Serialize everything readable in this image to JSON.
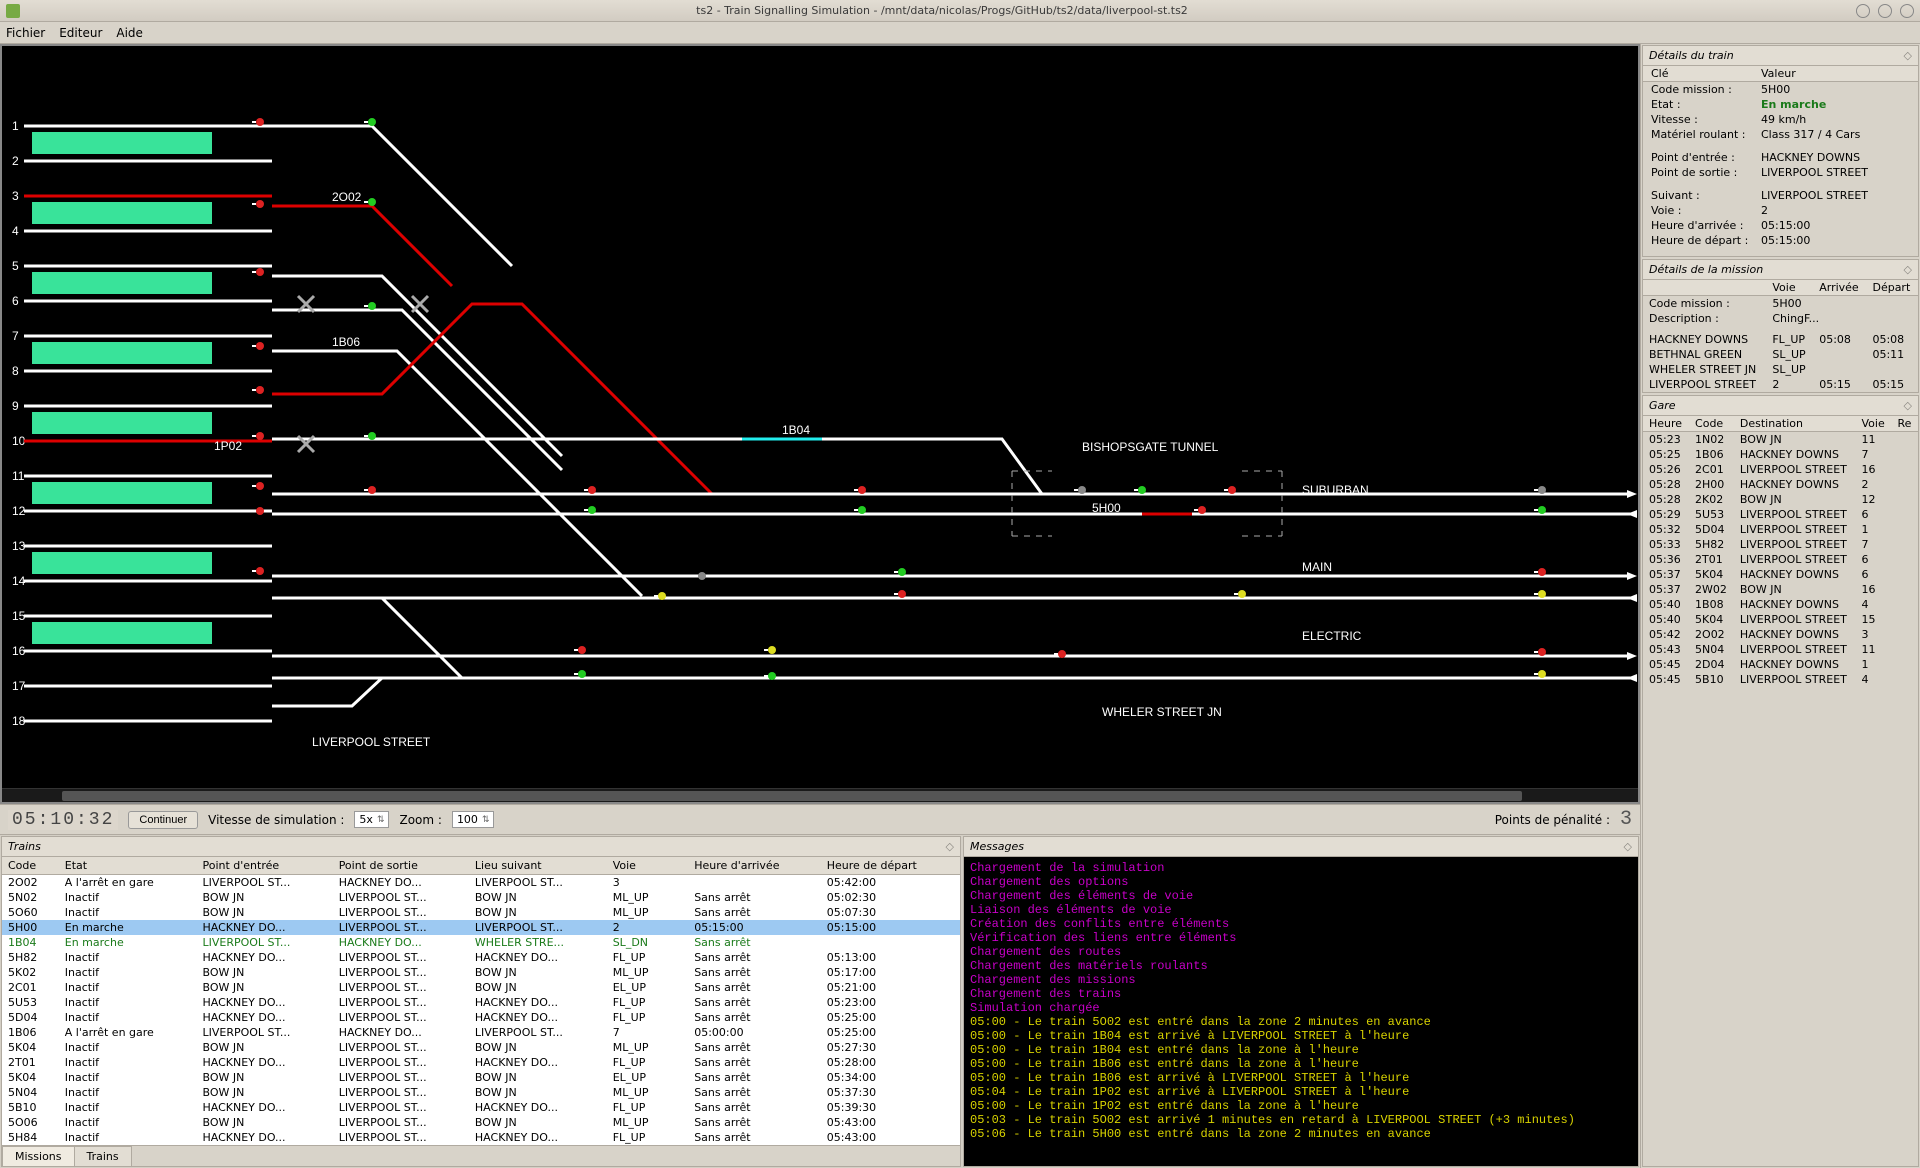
{
  "window": {
    "title": "ts2 - Train Signalling Simulation - /mnt/data/nicolas/Progs/GitHub/ts2/data/liverpool-st.ts2"
  },
  "menubar": {
    "file": "Fichier",
    "edit": "Editeur",
    "help": "Aide"
  },
  "track_labels": {
    "station": "LIVERPOOL STREET",
    "tunnel": "BISHOPSGATE TUNNEL",
    "wheler": "WHELER STREET JN",
    "suburban": "SUBURBAN",
    "main": "MAIN",
    "electric": "ELECTRIC",
    "t2002": "2O02",
    "t1B06": "1B06",
    "t1P02": "1P02",
    "t1B04": "1B04",
    "t5H00": "5H00"
  },
  "platform_numbers": [
    "1",
    "2",
    "3",
    "4",
    "5",
    "6",
    "7",
    "8",
    "9",
    "10",
    "11",
    "12",
    "13",
    "14",
    "15",
    "16",
    "17",
    "18"
  ],
  "controls": {
    "clock": "05:10:32",
    "continue_btn": "Continuer",
    "sim_speed_label": "Vitesse de simulation :",
    "sim_speed_value": "5x",
    "zoom_label": "Zoom :",
    "zoom_value": "100",
    "penalty_label": "Points de pénalité :",
    "penalty_value": "3"
  },
  "details": {
    "header": "Détails du train",
    "col_key": "Clé",
    "col_val": "Valeur",
    "rows": [
      {
        "k": "Code mission :",
        "v": "5H00"
      },
      {
        "k": "Etat :",
        "v": "En marche",
        "green": true
      },
      {
        "k": "Vitesse :",
        "v": "49 km/h"
      },
      {
        "k": "Matériel roulant :",
        "v": "Class 317 / 4 Cars"
      }
    ],
    "rows2": [
      {
        "k": "Point d'entrée :",
        "v": "HACKNEY DOWNS"
      },
      {
        "k": "Point de sortie :",
        "v": "LIVERPOOL STREET"
      }
    ],
    "rows3": [
      {
        "k": "Suivant :",
        "v": "LIVERPOOL STREET"
      },
      {
        "k": "Voie :",
        "v": "2"
      },
      {
        "k": "Heure d'arrivée :",
        "v": "05:15:00"
      },
      {
        "k": "Heure de départ :",
        "v": "05:15:00"
      }
    ]
  },
  "mission": {
    "header": "Détails de la mission",
    "cols": [
      "",
      "Voie",
      "Arrivée",
      "Départ"
    ],
    "intro": [
      {
        "k": "Code mission :",
        "v": "5H00"
      },
      {
        "k": "Description :",
        "v": "ChingF..."
      }
    ],
    "rows": [
      {
        "name": "HACKNEY DOWNS",
        "voie": "FL_UP",
        "arr": "05:08",
        "dep": "05:08"
      },
      {
        "name": "BETHNAL GREEN",
        "voie": "SL_UP",
        "arr": "",
        "dep": "05:11"
      },
      {
        "name": "WHELER STREET JN",
        "voie": "SL_UP",
        "arr": "",
        "dep": ""
      },
      {
        "name": "LIVERPOOL STREET",
        "voie": "2",
        "arr": "05:15",
        "dep": "05:15"
      }
    ]
  },
  "station": {
    "header": "Gare",
    "cols": [
      "Heure",
      "Code",
      "Destination",
      "Voie",
      "Re"
    ],
    "rows": [
      {
        "h": "05:23",
        "c": "1N02",
        "d": "BOW JN",
        "v": "11"
      },
      {
        "h": "05:25",
        "c": "1B06",
        "d": "HACKNEY DOWNS",
        "v": "7"
      },
      {
        "h": "05:26",
        "c": "2C01",
        "d": "LIVERPOOL STREET",
        "v": "16"
      },
      {
        "h": "05:28",
        "c": "2H00",
        "d": "HACKNEY DOWNS",
        "v": "2"
      },
      {
        "h": "05:28",
        "c": "2K02",
        "d": "BOW JN",
        "v": "12"
      },
      {
        "h": "05:29",
        "c": "5U53",
        "d": "LIVERPOOL STREET",
        "v": "6"
      },
      {
        "h": "05:32",
        "c": "5D04",
        "d": "LIVERPOOL STREET",
        "v": "1"
      },
      {
        "h": "05:33",
        "c": "5H82",
        "d": "LIVERPOOL STREET",
        "v": "7"
      },
      {
        "h": "05:36",
        "c": "2T01",
        "d": "LIVERPOOL STREET",
        "v": "6"
      },
      {
        "h": "05:37",
        "c": "5K04",
        "d": "HACKNEY DOWNS",
        "v": "6"
      },
      {
        "h": "05:37",
        "c": "2W02",
        "d": "BOW JN",
        "v": "16"
      },
      {
        "h": "05:40",
        "c": "1B08",
        "d": "HACKNEY DOWNS",
        "v": "4"
      },
      {
        "h": "05:40",
        "c": "5K04",
        "d": "LIVERPOOL STREET",
        "v": "15"
      },
      {
        "h": "05:42",
        "c": "2O02",
        "d": "HACKNEY DOWNS",
        "v": "3"
      },
      {
        "h": "05:43",
        "c": "5N04",
        "d": "LIVERPOOL STREET",
        "v": "11"
      },
      {
        "h": "05:45",
        "c": "2D04",
        "d": "HACKNEY DOWNS",
        "v": "1"
      },
      {
        "h": "05:45",
        "c": "5B10",
        "d": "LIVERPOOL STREET",
        "v": "4"
      }
    ]
  },
  "trains": {
    "header": "Trains",
    "cols": [
      "Code",
      "Etat",
      "Point d'entrée",
      "Point de sortie",
      "Lieu suivant",
      "Voie",
      "",
      "Heure d'arrivée",
      "Heure de départ"
    ],
    "rows": [
      {
        "c": "2O02",
        "e": "A l'arrêt en gare",
        "pe": "LIVERPOOL ST...",
        "ps": "HACKNEY DO...",
        "ls": "LIVERPOOL ST...",
        "v": "3",
        "ha": "",
        "hd": "05:42:00"
      },
      {
        "c": "5N02",
        "e": "Inactif",
        "pe": "BOW JN",
        "ps": "LIVERPOOL ST...",
        "ls": "BOW JN",
        "v": "ML_UP",
        "ha": "Sans arrêt",
        "hd": "05:02:30"
      },
      {
        "c": "5O60",
        "e": "Inactif",
        "pe": "BOW JN",
        "ps": "LIVERPOOL ST...",
        "ls": "BOW JN",
        "v": "ML_UP",
        "ha": "Sans arrêt",
        "hd": "05:07:30"
      },
      {
        "c": "5H00",
        "e": "En marche",
        "pe": "HACKNEY DO...",
        "ps": "LIVERPOOL ST...",
        "ls": "LIVERPOOL ST...",
        "v": "2",
        "ha": "05:15:00",
        "hd": "05:15:00",
        "sel": true
      },
      {
        "c": "1B04",
        "e": "En marche",
        "pe": "LIVERPOOL ST...",
        "ps": "HACKNEY DO...",
        "ls": "WHELER STRE...",
        "v": "SL_DN",
        "ha": "Sans arrêt",
        "hd": "",
        "green": true
      },
      {
        "c": "5H82",
        "e": "Inactif",
        "pe": "HACKNEY DO...",
        "ps": "LIVERPOOL ST...",
        "ls": "HACKNEY DO...",
        "v": "FL_UP",
        "ha": "Sans arrêt",
        "hd": "05:13:00"
      },
      {
        "c": "5K02",
        "e": "Inactif",
        "pe": "BOW JN",
        "ps": "LIVERPOOL ST...",
        "ls": "BOW JN",
        "v": "ML_UP",
        "ha": "Sans arrêt",
        "hd": "05:17:00"
      },
      {
        "c": "2C01",
        "e": "Inactif",
        "pe": "BOW JN",
        "ps": "LIVERPOOL ST...",
        "ls": "BOW JN",
        "v": "EL_UP",
        "ha": "Sans arrêt",
        "hd": "05:21:00"
      },
      {
        "c": "5U53",
        "e": "Inactif",
        "pe": "HACKNEY DO...",
        "ps": "LIVERPOOL ST...",
        "ls": "HACKNEY DO...",
        "v": "FL_UP",
        "ha": "Sans arrêt",
        "hd": "05:23:00"
      },
      {
        "c": "5D04",
        "e": "Inactif",
        "pe": "HACKNEY DO...",
        "ps": "LIVERPOOL ST...",
        "ls": "HACKNEY DO...",
        "v": "FL_UP",
        "ha": "Sans arrêt",
        "hd": "05:25:00"
      },
      {
        "c": "1B06",
        "e": "A l'arrêt en gare",
        "pe": "LIVERPOOL ST...",
        "ps": "HACKNEY DO...",
        "ls": "LIVERPOOL ST...",
        "v": "7",
        "ha": "05:00:00",
        "hd": "05:25:00"
      },
      {
        "c": "5K04",
        "e": "Inactif",
        "pe": "BOW JN",
        "ps": "LIVERPOOL ST...",
        "ls": "BOW JN",
        "v": "ML_UP",
        "ha": "Sans arrêt",
        "hd": "05:27:30"
      },
      {
        "c": "2T01",
        "e": "Inactif",
        "pe": "HACKNEY DO...",
        "ps": "LIVERPOOL ST...",
        "ls": "HACKNEY DO...",
        "v": "FL_UP",
        "ha": "Sans arrêt",
        "hd": "05:28:00"
      },
      {
        "c": "5K04",
        "e": "Inactif",
        "pe": "BOW JN",
        "ps": "LIVERPOOL ST...",
        "ls": "BOW JN",
        "v": "EL_UP",
        "ha": "Sans arrêt",
        "hd": "05:34:00"
      },
      {
        "c": "5N04",
        "e": "Inactif",
        "pe": "BOW JN",
        "ps": "LIVERPOOL ST...",
        "ls": "BOW JN",
        "v": "ML_UP",
        "ha": "Sans arrêt",
        "hd": "05:37:30"
      },
      {
        "c": "5B10",
        "e": "Inactif",
        "pe": "HACKNEY DO...",
        "ps": "LIVERPOOL ST...",
        "ls": "HACKNEY DO...",
        "v": "FL_UP",
        "ha": "Sans arrêt",
        "hd": "05:39:30"
      },
      {
        "c": "5O06",
        "e": "Inactif",
        "pe": "BOW JN",
        "ps": "LIVERPOOL ST...",
        "ls": "BOW JN",
        "v": "ML_UP",
        "ha": "Sans arrêt",
        "hd": "05:43:00"
      },
      {
        "c": "5H84",
        "e": "Inactif",
        "pe": "HACKNEY DO...",
        "ps": "LIVERPOOL ST...",
        "ls": "HACKNEY DO...",
        "v": "FL_UP",
        "ha": "Sans arrêt",
        "hd": "05:43:00"
      }
    ],
    "tabs": {
      "missions": "Missions",
      "trains": "Trains",
      "active": "missions"
    }
  },
  "messages": {
    "header": "Messages",
    "lines": [
      {
        "t": "Chargement de la simulation"
      },
      {
        "t": "Chargement des options"
      },
      {
        "t": "Chargement des éléments de voie"
      },
      {
        "t": "Liaison des éléments de voie"
      },
      {
        "t": "Création des conflits entre éléments"
      },
      {
        "t": "Vérification des liens entre éléments"
      },
      {
        "t": "Chargement des routes"
      },
      {
        "t": "Chargement des matériels roulants"
      },
      {
        "t": "Chargement des missions"
      },
      {
        "t": "Chargement des trains"
      },
      {
        "t": "Simulation chargée"
      },
      {
        "t": "05:00 - Le train 5O02 est entré dans la zone 2 minutes en avance",
        "y": true
      },
      {
        "t": "05:00 - Le train 1B04 est arrivé à LIVERPOOL STREET à l'heure",
        "y": true
      },
      {
        "t": "05:00 - Le train 1B04 est entré dans la zone à l'heure",
        "y": true
      },
      {
        "t": "05:00 - Le train 1B06 est entré dans la zone à l'heure",
        "y": true
      },
      {
        "t": "05:00 - Le train 1B06 est arrivé à LIVERPOOL STREET à l'heure",
        "y": true
      },
      {
        "t": "05:04 - Le train 1P02 est arrivé à LIVERPOOL STREET à l'heure",
        "y": true
      },
      {
        "t": "05:00 - Le train 1P02 est entré dans la zone à l'heure",
        "y": true
      },
      {
        "t": "05:03 - Le train 5O02 est arrivé 1 minutes en retard à LIVERPOOL STREET (+3 minutes)",
        "y": true
      },
      {
        "t": "05:06 - Le train 5H00 est entré dans la zone 2 minutes en avance",
        "y": true
      }
    ]
  }
}
